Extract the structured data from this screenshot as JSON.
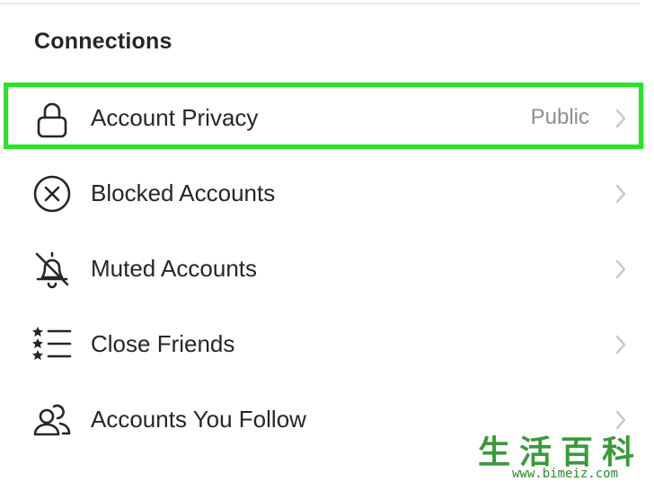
{
  "section": {
    "title": "Connections"
  },
  "items": [
    {
      "label": "Account Privacy",
      "value": "Public",
      "icon": "lock-icon"
    },
    {
      "label": "Blocked Accounts",
      "value": "",
      "icon": "blocked-icon"
    },
    {
      "label": "Muted Accounts",
      "value": "",
      "icon": "muted-bell-icon"
    },
    {
      "label": "Close Friends",
      "value": "",
      "icon": "star-list-icon"
    },
    {
      "label": "Accounts You Follow",
      "value": "",
      "icon": "people-icon"
    }
  ],
  "colors": {
    "highlight": "#26e526",
    "text": "#262626",
    "secondary_text": "#8e8e8e",
    "chevron": "#c7c7c7"
  },
  "watermark": {
    "logo_text": "生活百科",
    "url": "www.bimeiz.com"
  }
}
